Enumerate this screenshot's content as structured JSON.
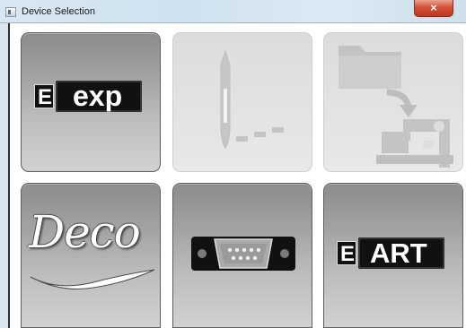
{
  "window": {
    "title": "Device Selection",
    "close_glyph": "×"
  },
  "tiles": [
    {
      "id": "exp",
      "badge_letter": "E",
      "label": "exp",
      "state": "enabled",
      "icon": "exp-logo-icon"
    },
    {
      "id": "pen",
      "label": "",
      "state": "disabled",
      "icon": "pen-icon"
    },
    {
      "id": "machine",
      "label": "",
      "state": "disabled",
      "icon": "folder-to-sewing-machine-icon"
    },
    {
      "id": "deco",
      "label": "Deco",
      "state": "enabled",
      "icon": "deco-logo-icon"
    },
    {
      "id": "port",
      "label": "",
      "state": "enabled",
      "icon": "serial-port-icon"
    },
    {
      "id": "art",
      "badge_letter": "E",
      "label": "ART",
      "state": "enabled",
      "icon": "art-logo-icon"
    }
  ],
  "colors": {
    "tile_enabled_top": "#8c8c8c",
    "tile_enabled_bottom": "#d2d2d2",
    "tile_disabled": "#e2e2e2",
    "logo_black": "#111111",
    "close_red": "#c2341d"
  }
}
